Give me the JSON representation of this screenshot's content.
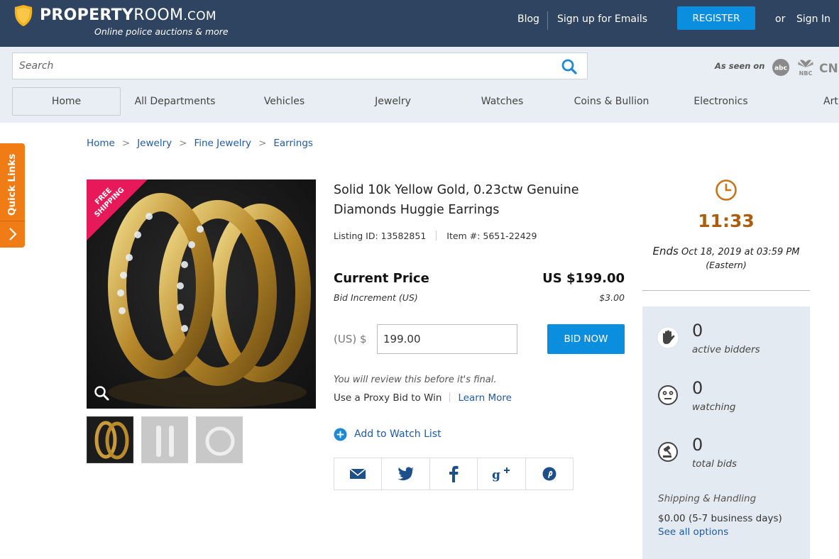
{
  "header": {
    "logo_bold": "PROPERTY",
    "logo_light": "ROOM",
    "logo_suffix": ".COM",
    "tagline": "Online police auctions & more",
    "blog": "Blog",
    "signup": "Sign up for Emails",
    "register": "REGISTER",
    "or": "or",
    "signin": "Sign In"
  },
  "search": {
    "placeholder": "Search",
    "seen_on": "As seen on"
  },
  "media_logos": [
    "abc",
    "NBC",
    "CNN"
  ],
  "nav": {
    "items": [
      "Home",
      "All Departments",
      "Vehicles",
      "Jewelry",
      "Watches",
      "Coins & Bullion",
      "Electronics",
      "Art"
    ]
  },
  "quick_links": "Quick Links",
  "breadcrumb": [
    "Home",
    "Jewelry",
    "Fine Jewelry",
    "Earrings"
  ],
  "image": {
    "badge": "FREE SHIPPING",
    "badge_line1": "FREE",
    "badge_line2": "SHIPPING"
  },
  "product": {
    "title": "Solid 10k Yellow Gold, 0.23ctw Genuine Diamonds Huggie Earrings",
    "listing_id": "Listing ID: 13582851",
    "item_no": "Item #: 5651-22429",
    "current_price_label": "Current Price",
    "current_price": "US $199.00",
    "bid_increment_label": "Bid Increment (US)",
    "bid_increment": "$3.00",
    "currency_label": "(US) $",
    "bid_value": "199.00",
    "bid_button": "BID NOW",
    "review_note": "You will review this before it's final.",
    "proxy_text": "Use a Proxy Bid to Win",
    "learn_more": "Learn More",
    "watch_list": "Add to Watch List"
  },
  "share_icons": [
    "email-icon",
    "twitter-icon",
    "facebook-icon",
    "google-plus-icon",
    "pinterest-icon"
  ],
  "auction": {
    "time_left": "11:33",
    "ends_word": "Ends",
    "ends_date": "Oct 18, 2019 at 03:59 PM",
    "timezone": "(Eastern)"
  },
  "stats": {
    "bidders_count": "0",
    "bidders_label": "active bidders",
    "watching_count": "0",
    "watching_label": "watching",
    "bids_count": "0",
    "bids_label": "total bids",
    "shipping_label": "Shipping & Handling",
    "shipping_value": "$0.00 (5-7 business days)",
    "shipping_link": "See all options"
  },
  "colors": {
    "header_bg": "#2f4461",
    "accent_blue": "#0b8ede",
    "link_blue": "#1f5aa6",
    "timer_orange": "#a95f0f",
    "quick_links_orange": "#f07c16",
    "badge_pink": "#e8195a"
  }
}
